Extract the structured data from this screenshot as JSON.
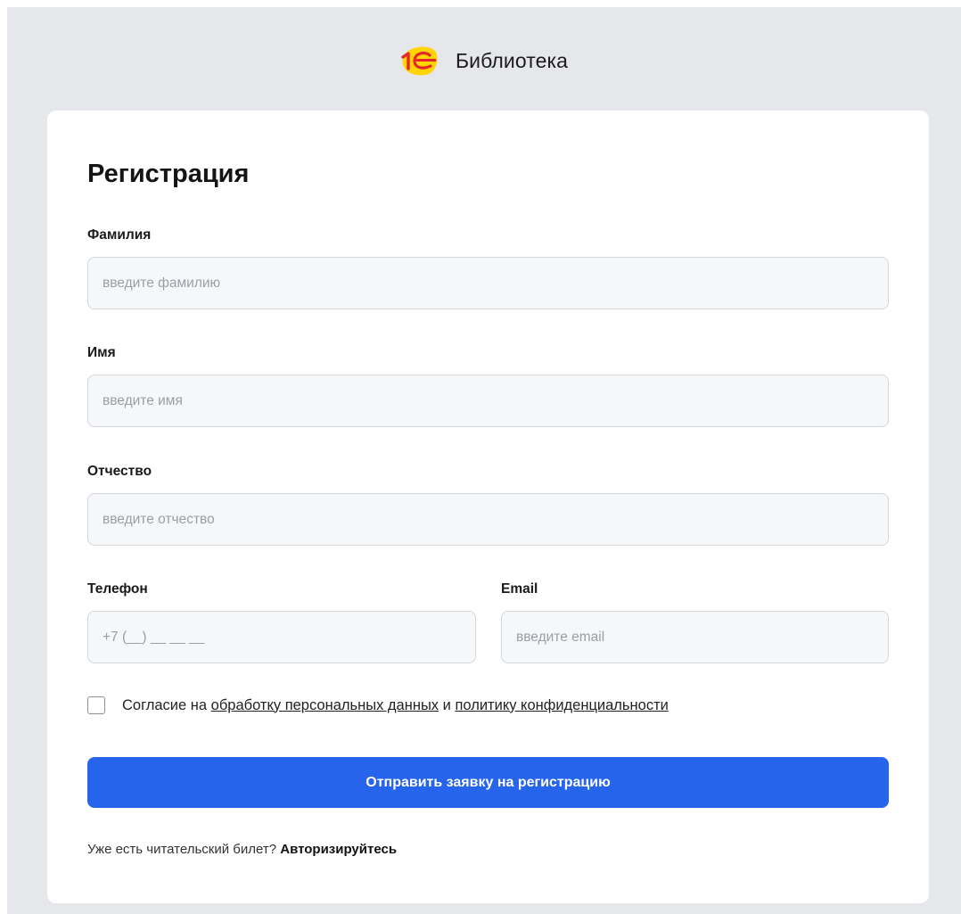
{
  "header": {
    "title": "Библиотека",
    "logo_icon": "1c-logo-icon"
  },
  "form": {
    "title": "Регистрация",
    "fields": {
      "lastname": {
        "label": "Фамилия",
        "placeholder": "введите фамилию"
      },
      "firstname": {
        "label": "Имя",
        "placeholder": "введите имя"
      },
      "patronymic": {
        "label": "Отчество",
        "placeholder": "введите отчество"
      },
      "phone": {
        "label": "Телефон",
        "placeholder": "+7 (__) __ __ __"
      },
      "email": {
        "label": "Email",
        "placeholder": "введите email"
      }
    },
    "consent": {
      "checked": false,
      "prefix": "Согласие на ",
      "link1": "обработку персональных данных",
      "middle": " и ",
      "link2": "политику конфиденциальности"
    },
    "submit_label": "Отправить заявку на регистрацию",
    "login_prompt": "Уже есть читательский билет? ",
    "login_link": "Авторизируйтесь"
  },
  "colors": {
    "accent": "#2764ec",
    "background": "#e6e7ea",
    "logo_red": "#e3262a",
    "logo_yellow": "#ffd400"
  }
}
